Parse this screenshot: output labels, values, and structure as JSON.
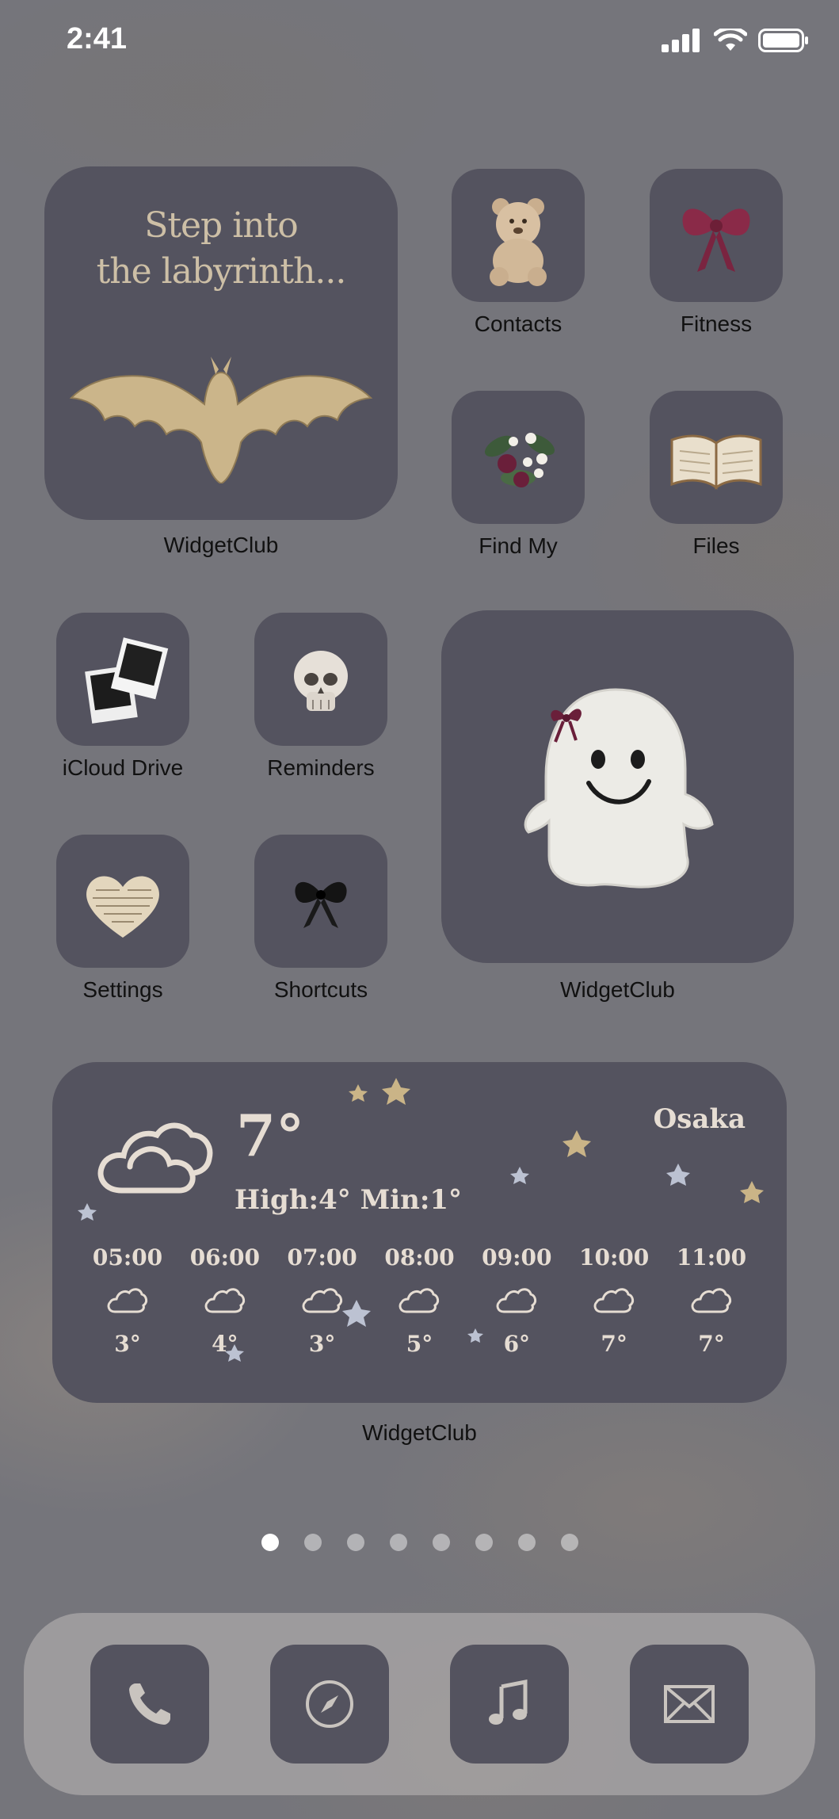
{
  "status_bar": {
    "time": "2:41"
  },
  "widgets": {
    "big_top": {
      "headline_line1": "Step into",
      "headline_line2": "the labyrinth...",
      "label": "WidgetClub"
    },
    "ghost": {
      "label": "WidgetClub"
    },
    "weather": {
      "label": "WidgetClub",
      "city": "Osaka",
      "temperature": "7°",
      "high_low": "High:4° Min:1°",
      "hourly": [
        {
          "time": "05:00",
          "temp": "3°"
        },
        {
          "time": "06:00",
          "temp": "4°"
        },
        {
          "time": "07:00",
          "temp": "3°"
        },
        {
          "time": "08:00",
          "temp": "5°"
        },
        {
          "time": "09:00",
          "temp": "6°"
        },
        {
          "time": "10:00",
          "temp": "7°"
        },
        {
          "time": "11:00",
          "temp": "7°"
        }
      ]
    }
  },
  "apps": [
    {
      "label": "Contacts",
      "icon": "teddy-bear-icon"
    },
    {
      "label": "Fitness",
      "icon": "ribbon-bow-icon"
    },
    {
      "label": "Find My",
      "icon": "flower-bouquet-icon"
    },
    {
      "label": "Files",
      "icon": "open-book-icon"
    },
    {
      "label": "iCloud Drive",
      "icon": "polaroid-photos-icon"
    },
    {
      "label": "Reminders",
      "icon": "skull-icon"
    },
    {
      "label": "Settings",
      "icon": "paper-heart-icon"
    },
    {
      "label": "Shortcuts",
      "icon": "black-bow-icon"
    }
  ],
  "page_dots": {
    "count": 8,
    "active_index": 0
  },
  "dock": [
    {
      "icon": "phone-icon"
    },
    {
      "icon": "compass-icon"
    },
    {
      "icon": "music-note-icon"
    },
    {
      "icon": "mail-icon"
    }
  ],
  "colors": {
    "tile": "#54535f",
    "text_light": "#e6ddd3"
  }
}
